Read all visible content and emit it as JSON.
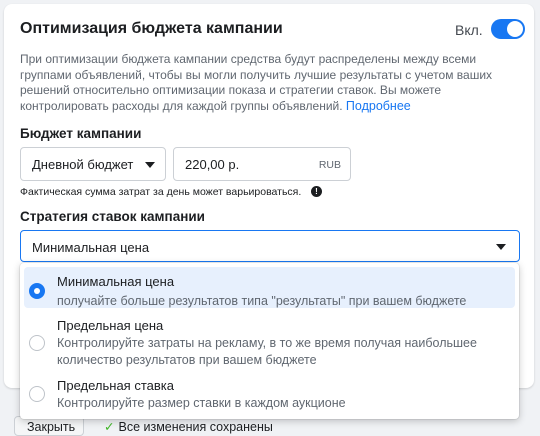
{
  "section": {
    "title": "Оптимизация бюджета кампании",
    "toggle_label": "Вкл.",
    "toggle_on": true,
    "description": "При оптимизации бюджета кампании средства будут распределены между всеми группами объявлений, чтобы вы могли получить лучшие результаты с учетом ваших решений относительно оптимизации показа и стратегии ставок. Вы можете контролировать расходы для каждой группы объявлений.",
    "learn_more": "Подробнее"
  },
  "budget": {
    "label": "Бюджет кампании",
    "type_value": "Дневной бюджет",
    "amount_value": "220,00 р.",
    "currency": "RUB",
    "note": "Фактическая сумма затрат за день может варьироваться."
  },
  "strategy": {
    "label": "Стратегия ставок кампании",
    "selected": "Минимальная цена",
    "options": [
      {
        "title": "Минимальная цена",
        "subtitle": "получайте больше результатов типа \"результаты\" при вашем бюджете",
        "selected": true
      },
      {
        "title": "Предельная цена",
        "subtitle": "Контролируйте затраты на рекламу, в то же время получая наибольшее количество результатов при вашем бюджете",
        "selected": false
      },
      {
        "title": "Предельная ставка",
        "subtitle": "Контролируйте размер ставки в каждом аукционе",
        "selected": false
      }
    ]
  },
  "footer": {
    "close_label": "Закрыть",
    "saved_label": "Все изменения сохранены"
  },
  "colors": {
    "accent": "#1877f2",
    "selected_bg": "#e7f0fd"
  }
}
